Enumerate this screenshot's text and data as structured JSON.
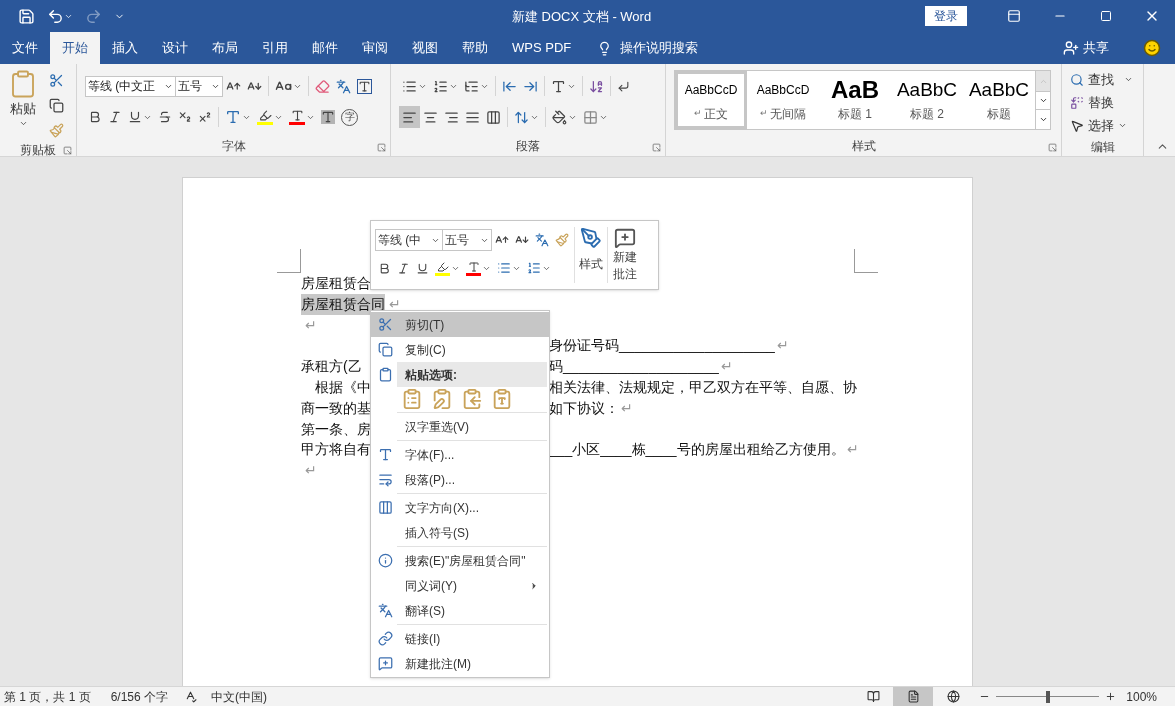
{
  "window": {
    "title": "新建 DOCX 文档 - Word",
    "sign_in": "登录"
  },
  "quick_access": {
    "redo": {
      "disabled": true
    }
  },
  "tabs": [
    {
      "label": "文件",
      "selected": false
    },
    {
      "label": "开始",
      "selected": true
    },
    {
      "label": "插入",
      "selected": false
    },
    {
      "label": "设计",
      "selected": false
    },
    {
      "label": "布局",
      "selected": false
    },
    {
      "label": "引用",
      "selected": false
    },
    {
      "label": "邮件",
      "selected": false
    },
    {
      "label": "审阅",
      "selected": false
    },
    {
      "label": "视图",
      "selected": false
    },
    {
      "label": "帮助",
      "selected": false
    },
    {
      "label": "WPS PDF",
      "selected": false
    }
  ],
  "tell_me": "操作说明搜索",
  "share": "共享",
  "ribbon": {
    "clipboard": {
      "paste": "粘贴",
      "label": "剪贴板"
    },
    "font": {
      "font_name": "等线 (中文正",
      "font_size": "五号",
      "enclosed_glyph": "字",
      "label": "字体"
    },
    "paragraph": {
      "alignments": [
        {
          "selected": true
        },
        {
          "selected": false
        },
        {
          "selected": false
        },
        {
          "selected": false
        },
        {
          "selected": false
        }
      ],
      "label": "段落"
    },
    "styles": {
      "items": [
        {
          "preview": "AaBbCcD",
          "mark": "↵",
          "name": "正文",
          "selected": true,
          "kind": "normal"
        },
        {
          "preview": "AaBbCcD",
          "mark": "↵",
          "name": "无间隔",
          "selected": false,
          "kind": "normal"
        },
        {
          "preview": "AaB",
          "name": "标题 1",
          "selected": false,
          "kind": "heading1"
        },
        {
          "preview": "AaBbC",
          "name": "标题 2",
          "selected": false,
          "kind": "heading2"
        },
        {
          "preview": "AaBbC",
          "name": "标题",
          "selected": false,
          "kind": "title"
        }
      ],
      "label": "样式"
    },
    "editing": {
      "find": "查找",
      "replace": "替换",
      "select": "选择",
      "label": "编辑"
    }
  },
  "document": {
    "lines": [
      {
        "left": "房屋租赁合",
        "selected": false
      },
      {
        "left": "房屋租赁合同",
        "end": "↵",
        "selected": true
      },
      {
        "end": "↵",
        "selected": false
      },
      {
        "right": "身份证号码____________________",
        "end": "↵",
        "selected": false
      },
      {
        "left": "承租方(乙",
        "right": "码____________________",
        "end": "↵",
        "selected": false
      },
      {
        "left": "　根据《中",
        "right": "相关法律、法规规定，甲乙双方在平等、自愿、协",
        "selected": false
      },
      {
        "left": "商一致的基",
        "right": "如下协议：",
        "end": "↵",
        "selected": false
      },
      {
        "left": "第一条、房",
        "selected": false
      },
      {
        "left": "甲方将自有",
        "right": "___小区____栋____号的房屋出租给乙方使用。",
        "end": "↵",
        "selected": false
      },
      {
        "end": "↵",
        "selected": false
      }
    ]
  },
  "mini_toolbar": {
    "font_name": "等线 (中",
    "font_size": "五号",
    "styles": "样式",
    "new_comment": "新建批注"
  },
  "context_menu": {
    "items": [
      {
        "kind": "item",
        "label": "剪切(T)",
        "selected": true,
        "separator": false,
        "submenu": false
      },
      {
        "kind": "item",
        "label": "复制(C)",
        "selected": false,
        "separator": false,
        "submenu": false
      },
      {
        "kind": "header",
        "label": "粘贴选项:",
        "selected": false,
        "separator": false
      },
      {
        "kind": "paste_options",
        "selected": false,
        "separator": false
      },
      {
        "kind": "item",
        "label": "汉字重选(V)",
        "selected": false,
        "separator": true,
        "submenu": false
      },
      {
        "kind": "item",
        "label": "字体(F)...",
        "selected": false,
        "separator": true,
        "submenu": false
      },
      {
        "kind": "item",
        "label": "段落(P)...",
        "selected": false,
        "separator": false,
        "submenu": false
      },
      {
        "kind": "item",
        "label": "文字方向(X)...",
        "selected": false,
        "separator": true,
        "submenu": false
      },
      {
        "kind": "item",
        "label": "插入符号(S)",
        "selected": false,
        "separator": false,
        "submenu": false
      },
      {
        "kind": "item",
        "label": "搜索(E)\"房屋租赁合同\"",
        "selected": false,
        "separator": true,
        "submenu": false
      },
      {
        "kind": "item",
        "label": "同义词(Y)",
        "selected": false,
        "separator": false,
        "submenu": true
      },
      {
        "kind": "item",
        "label": "翻译(S)",
        "selected": false,
        "separator": false,
        "submenu": false
      },
      {
        "kind": "item",
        "label": "链接(I)",
        "selected": false,
        "separator": true,
        "submenu": false
      },
      {
        "kind": "item",
        "label": "新建批注(M)",
        "selected": false,
        "separator": false,
        "submenu": false
      }
    ]
  },
  "status_bar": {
    "page": "第 1 页，共 1 页",
    "words": "6/156 个字",
    "language": "中文(中国)",
    "views": [
      {
        "selected": false
      },
      {
        "selected": true
      },
      {
        "selected": false
      }
    ],
    "zoom": {
      "level": 0.5,
      "reading": "100%"
    }
  }
}
